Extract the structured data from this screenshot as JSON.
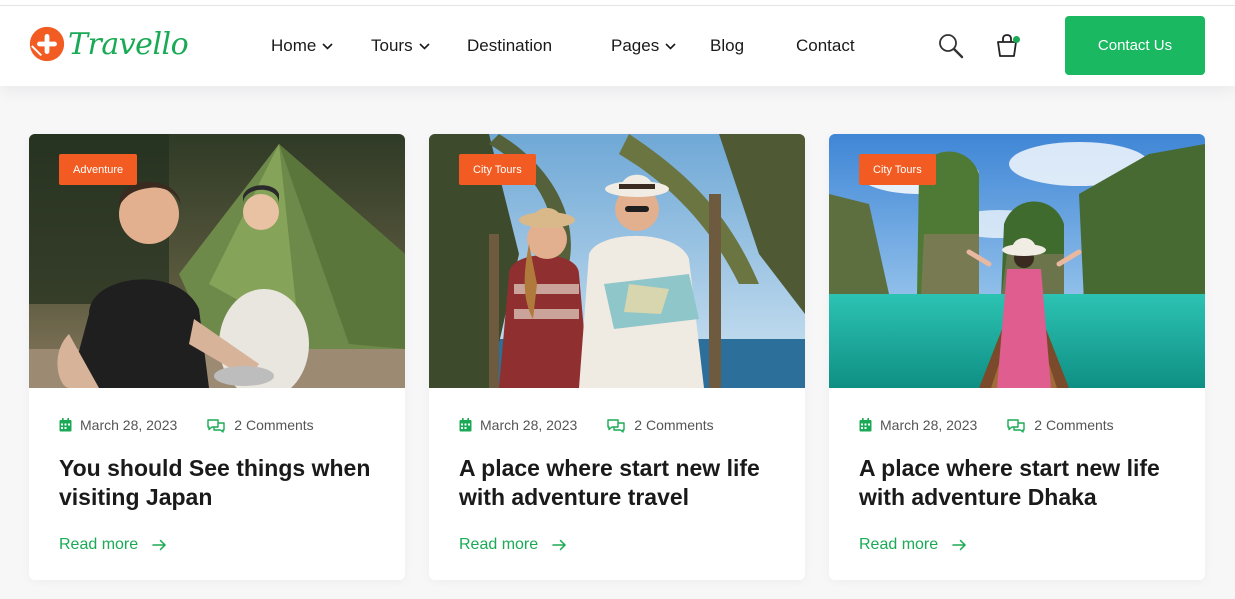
{
  "brand": {
    "name": "Travello",
    "accent": "#1aaa55",
    "mark_color": "#f25c22"
  },
  "nav": {
    "items": [
      {
        "label": "Home",
        "has_dropdown": true
      },
      {
        "label": "Tours",
        "has_dropdown": true
      },
      {
        "label": "Destination",
        "has_dropdown": false
      },
      {
        "label": "Pages",
        "has_dropdown": true
      },
      {
        "label": "Blog",
        "has_dropdown": false
      },
      {
        "label": "Contact",
        "has_dropdown": false
      }
    ],
    "search_icon": "search-icon",
    "cart_icon": "shopping-bag-icon",
    "contact_button": "Contact Us"
  },
  "posts": [
    {
      "category": "Adventure",
      "date": "March 28, 2023",
      "comments": "2 Comments",
      "title": "You should See things when visiting Japan",
      "read_more": "Read more",
      "image": "couple-camping-tent"
    },
    {
      "category": "City Tours",
      "date": "March 28, 2023",
      "comments": "2 Comments",
      "title": "A place where start new life with adventure travel",
      "read_more": "Read more",
      "image": "travelers-with-map-palms"
    },
    {
      "category": "City Tours",
      "date": "March 28, 2023",
      "comments": "2 Comments",
      "title": "A place where start new life with adventure Dhaka",
      "read_more": "Read more",
      "image": "woman-boat-lagoon"
    }
  ],
  "colors": {
    "badge": "#f25c22",
    "button": "#1ab860",
    "link": "#1aaa55"
  }
}
